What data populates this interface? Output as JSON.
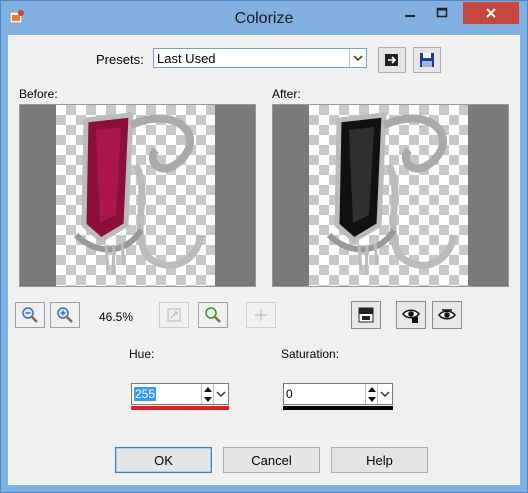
{
  "window": {
    "title": "Colorize"
  },
  "presets": {
    "label": "Presets:",
    "value": "Last Used"
  },
  "panes": {
    "before_label": "Before:",
    "after_label": "After:"
  },
  "zoom": {
    "level": "46.5%"
  },
  "hue": {
    "label": "Hue:",
    "value": "255",
    "bar_color": "#e81c24"
  },
  "saturation": {
    "label": "Saturation:",
    "value": "0",
    "bar_color": "#000000"
  },
  "buttons": {
    "ok": "OK",
    "cancel": "Cancel",
    "help": "Help"
  },
  "colors": {
    "title_bar": "#7fb0e0",
    "close_button": "#c7463e",
    "preview_fill_before": "#8a0f3a",
    "preview_fill_after": "#111111"
  },
  "icons": {
    "app": "colorize-app-icon",
    "minimize": "minimize-icon",
    "maximize": "maximize-icon",
    "close": "close-icon",
    "reset": "reset-preset-icon",
    "save": "save-preset-icon",
    "zoom_out": "zoom-out-icon",
    "zoom_in": "zoom-in-icon",
    "zoom_100": "actual-size-icon",
    "zoom_fit": "zoom-fit-icon",
    "pan": "pan-icon",
    "view_toggle": "show-previews-icon",
    "proof": "proof-icon",
    "auto_proof": "auto-proof-icon"
  }
}
